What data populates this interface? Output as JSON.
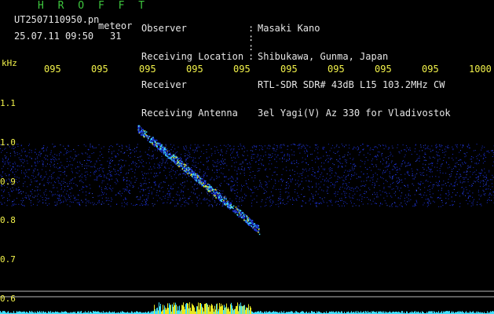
{
  "header": {
    "title": "H R O F F T",
    "filename": "UT2507110950.pn",
    "tag": "meteor",
    "datetime": "25.07.11 09:50",
    "count": "31"
  },
  "meta": {
    "labels": [
      "Observer",
      "Receiving Location",
      "Receiver",
      "Receiving Antenna"
    ],
    "values": [
      "Masaki Kano",
      "Shibukawa, Gunma, Japan",
      "RTL-SDR SDR# 43dB L15 103.2MHz CW",
      "3el Yagi(V) Az 330 for Vladivostok"
    ]
  },
  "axes": {
    "y_unit": "kHz",
    "x_ticks": [
      "095",
      "095",
      "095",
      "095",
      "095",
      "095",
      "095",
      "095",
      "095",
      "1000"
    ],
    "y_ticks": [
      "1.1",
      "1.0",
      "0.9",
      "0.8",
      "0.7",
      "0.6"
    ]
  },
  "colors": {
    "background": "#000000",
    "title_green": "#3ec63e",
    "axis_yellow": "#f2f24a",
    "noise_blue": "#1a2fd6",
    "signal_cyan": "#40e0ff",
    "signal_yellow": "#e8e820"
  }
}
